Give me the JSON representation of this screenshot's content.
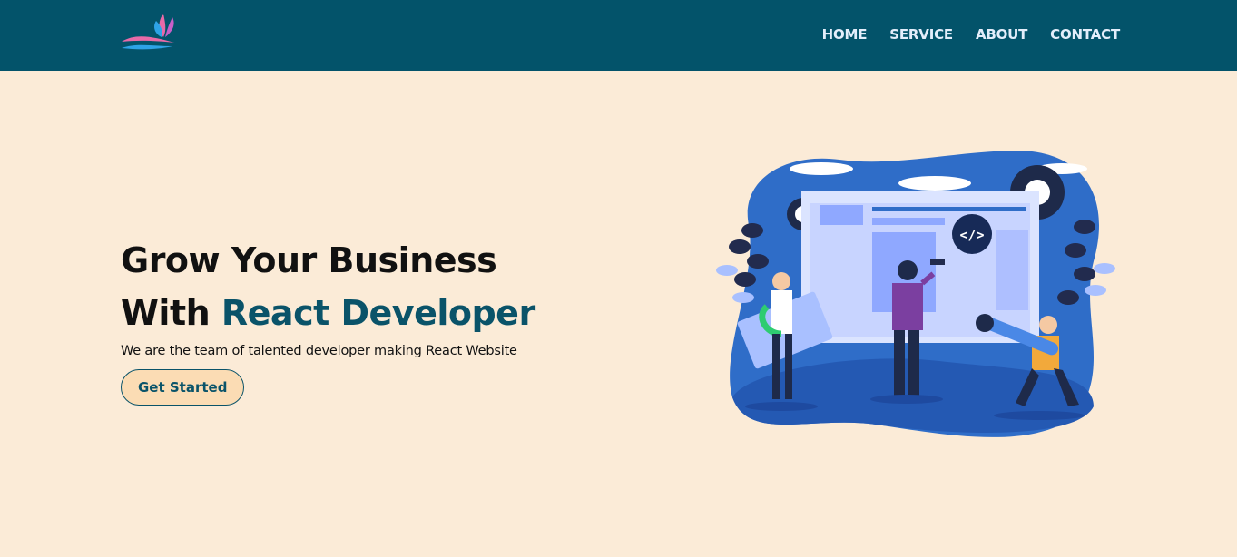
{
  "navbar": {
    "logo_icon": "butterfly-logo",
    "links": [
      "HOME",
      "SERVICE",
      "ABOUT",
      "CONTACT"
    ]
  },
  "hero": {
    "title_line1": "Grow Your Business",
    "title_line2_prefix": "With ",
    "title_line2_brand": "React Developer",
    "subtitle": "We are the team of talented developer making React Website",
    "cta_label": "Get Started",
    "illustration_icon": "web-development-team-illustration",
    "code_badge": "</>"
  },
  "colors": {
    "navbar_bg": "#03536a",
    "page_bg": "#fbebd7",
    "brand_text": "#0a5369",
    "cta_bg": "#fbdcb4"
  }
}
